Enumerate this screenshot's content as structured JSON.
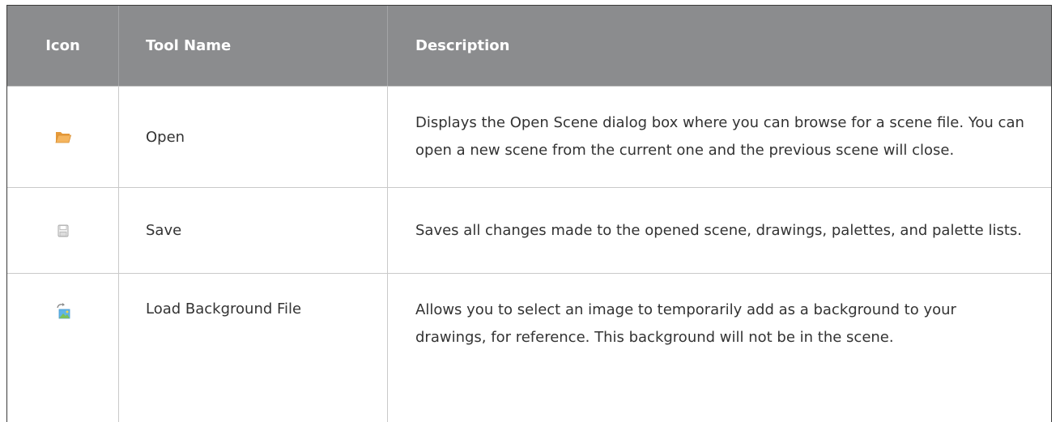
{
  "table": {
    "headers": {
      "icon": "Icon",
      "tool_name": "Tool Name",
      "description": "Description"
    },
    "rows": [
      {
        "icon": "folder-open-icon",
        "tool_name": "Open",
        "description": "Displays the Open Scene dialog box where you can browse for a scene file. You can open a new scene from the current one and the previous scene will close."
      },
      {
        "icon": "save-floppy-icon",
        "tool_name": "Save",
        "description": "Saves all changes made to the opened scene, drawings, palettes, and palette lists."
      },
      {
        "icon": "load-background-image-icon",
        "tool_name": "Load Background File",
        "description": "Allows you to select an image to temporarily add as a background to your drawings, for reference. This background will not be in the scene."
      }
    ]
  },
  "colors": {
    "header_bg": "#8b8c8e",
    "header_text": "#ffffff",
    "body_text": "#333333",
    "folder_icon": "#f2a94a"
  }
}
